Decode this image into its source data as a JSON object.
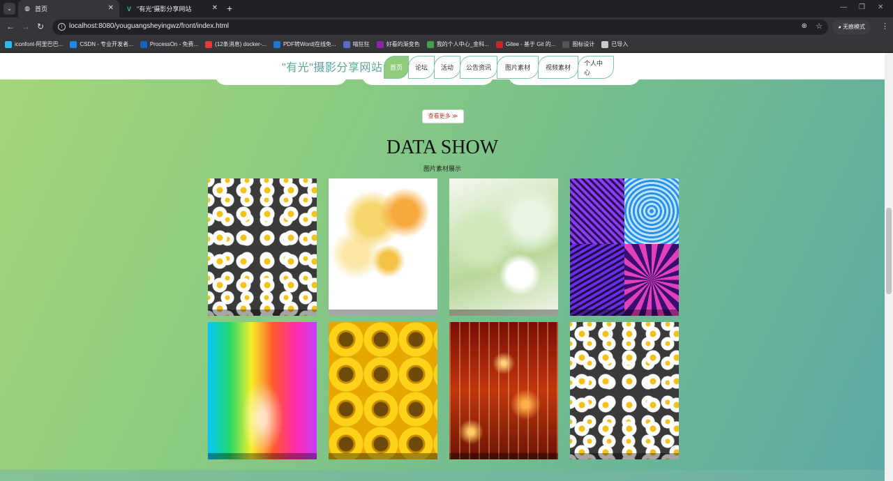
{
  "browser": {
    "tabs": [
      {
        "title": "首页",
        "active": true
      },
      {
        "title": "\"有光\"摄影分享网站",
        "active": false
      }
    ],
    "url": "localhost:8080/youguangsheyingwz/front/index.html",
    "incognito_label": "无痕模式",
    "bookmarks": [
      {
        "label": "iconfont-阿里巴巴...",
        "icon": "iconfont-icon",
        "color": "#2db7f5"
      },
      {
        "label": "CSDN - 专业开发者...",
        "icon": "csdn-icon",
        "color": "#1e88e5"
      },
      {
        "label": "ProcessOn - 免费...",
        "icon": "processon-icon",
        "color": "#1565c0"
      },
      {
        "label": "(12条消息) docker-...",
        "icon": "csdn-c-icon",
        "color": "#e53935"
      },
      {
        "label": "PDF转Word|在线免...",
        "icon": "pdf-icon",
        "color": "#1976d2"
      },
      {
        "label": "喵狂狂",
        "icon": "cat-icon",
        "color": "#5c6bc0"
      },
      {
        "label": "好看的渐变色",
        "icon": "gradient-icon",
        "color": "#8e24aa"
      },
      {
        "label": "我的个人中心_金科...",
        "icon": "profile-icon",
        "color": "#43a047"
      },
      {
        "label": "Gitee - 基于 Git 的...",
        "icon": "gitee-icon",
        "color": "#c62828"
      },
      {
        "label": "图标设计",
        "icon": "design-icon",
        "color": "#555555"
      },
      {
        "label": "已导入",
        "icon": "folder-icon",
        "color": "#cccccc"
      }
    ]
  },
  "site": {
    "title": "\"有光\"摄影分享网站",
    "menu": [
      "首页",
      "论坛",
      "活动",
      "公告资讯",
      "图片素材",
      "视频素材",
      "个人中心"
    ],
    "active_menu": "首页",
    "more_button": "查看更多 ≫",
    "section_title": "DATA SHOW",
    "section_subtitle": "图片素材展示",
    "gallery": [
      {
        "image": "daisy-dark-background"
      },
      {
        "image": "yellow-flowers-white-background"
      },
      {
        "image": "white-lily-green-leaves"
      },
      {
        "image": "psychedelic-swirl-patterns"
      },
      {
        "image": "rainbow-water-drop"
      },
      {
        "image": "sunflowers"
      },
      {
        "image": "red-sparkle-lights"
      },
      {
        "image": "daisy-dark-background"
      }
    ]
  }
}
